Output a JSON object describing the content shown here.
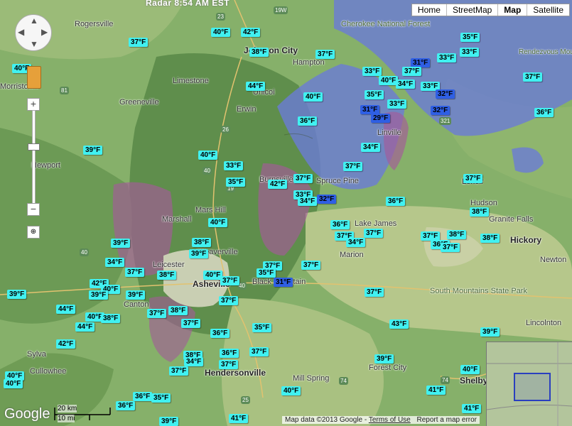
{
  "header": {
    "title": "Radar  8:54 AM EST"
  },
  "map_types": [
    "Home",
    "StreetMap",
    "Map",
    "Satellite"
  ],
  "active_map_type": "Map",
  "places": [
    {
      "name": "Rogersville"
    },
    {
      "name": "Johnson City"
    },
    {
      "name": "Hampton"
    },
    {
      "name": "Cherokee National Forest"
    },
    {
      "name": "Rendezvous Mountain Educational State Forest"
    },
    {
      "name": "Morristown"
    },
    {
      "name": "Limestone"
    },
    {
      "name": "Greeneville"
    },
    {
      "name": "Unicoi"
    },
    {
      "name": "Erwin"
    },
    {
      "name": "Newport"
    },
    {
      "name": "Linville"
    },
    {
      "name": "Burnsville"
    },
    {
      "name": "Spruce Pine"
    },
    {
      "name": "Lenoir"
    },
    {
      "name": "Hudson"
    },
    {
      "name": "Granite Falls"
    },
    {
      "name": "Marshall"
    },
    {
      "name": "Mars Hill"
    },
    {
      "name": "Weaverville"
    },
    {
      "name": "Lake James"
    },
    {
      "name": "Marion"
    },
    {
      "name": "Hickory"
    },
    {
      "name": "Newton"
    },
    {
      "name": "Leicester"
    },
    {
      "name": "Asheville"
    },
    {
      "name": "Black Mountain"
    },
    {
      "name": "Lincolnton"
    },
    {
      "name": "Canton"
    },
    {
      "name": "South Mountains State Park"
    },
    {
      "name": "Sylva"
    },
    {
      "name": "Hendersonville"
    },
    {
      "name": "Forest City"
    },
    {
      "name": "Mill Spring"
    },
    {
      "name": "Shelby"
    },
    {
      "name": "Cullowhee"
    }
  ],
  "temperatures": [
    {
      "t": "40°F"
    },
    {
      "t": "42°F"
    },
    {
      "t": "37°F"
    },
    {
      "t": "38°F"
    },
    {
      "t": "37°F"
    },
    {
      "t": "35°F"
    },
    {
      "t": "33°F"
    },
    {
      "t": "33°F"
    },
    {
      "t": "31°F",
      "cold": true
    },
    {
      "t": "37°F"
    },
    {
      "t": "33°F"
    },
    {
      "t": "40°F"
    },
    {
      "t": "34°F"
    },
    {
      "t": "33°F"
    },
    {
      "t": "32°F",
      "cold": true
    },
    {
      "t": "37°F"
    },
    {
      "t": "40°F"
    },
    {
      "t": "44°F"
    },
    {
      "t": "40°F"
    },
    {
      "t": "35°F"
    },
    {
      "t": "33°F"
    },
    {
      "t": "31°F",
      "cold": true
    },
    {
      "t": "29°F",
      "cold": true
    },
    {
      "t": "32°F",
      "cold": true
    },
    {
      "t": "36°F"
    },
    {
      "t": "36°F"
    },
    {
      "t": "39°F"
    },
    {
      "t": "40°F"
    },
    {
      "t": "34°F"
    },
    {
      "t": "37°F"
    },
    {
      "t": "33°F"
    },
    {
      "t": "35°F"
    },
    {
      "t": "42°F"
    },
    {
      "t": "37°F"
    },
    {
      "t": "33°F"
    },
    {
      "t": "34°F"
    },
    {
      "t": "32°F",
      "cold": true
    },
    {
      "t": "37°F"
    },
    {
      "t": "36°F"
    },
    {
      "t": "38°F"
    },
    {
      "t": "40°F"
    },
    {
      "t": "36°F"
    },
    {
      "t": "37°F"
    },
    {
      "t": "37°F"
    },
    {
      "t": "34°F"
    },
    {
      "t": "38°F"
    },
    {
      "t": "39°F"
    },
    {
      "t": "38°F"
    },
    {
      "t": "39°F"
    },
    {
      "t": "37°F"
    },
    {
      "t": "36°F"
    },
    {
      "t": "37°F"
    },
    {
      "t": "38°F"
    },
    {
      "t": "34°F"
    },
    {
      "t": "37°F"
    },
    {
      "t": "38°F"
    },
    {
      "t": "40°F"
    },
    {
      "t": "37°F"
    },
    {
      "t": "35°F"
    },
    {
      "t": "37°F"
    },
    {
      "t": "31°F",
      "cold": true
    },
    {
      "t": "37°F"
    },
    {
      "t": "39°F"
    },
    {
      "t": "42°F"
    },
    {
      "t": "40°F"
    },
    {
      "t": "39°F"
    },
    {
      "t": "39°F"
    },
    {
      "t": "44°F"
    },
    {
      "t": "37°F"
    },
    {
      "t": "38°F"
    },
    {
      "t": "37°F"
    },
    {
      "t": "40°F"
    },
    {
      "t": "38°F"
    },
    {
      "t": "44°F"
    },
    {
      "t": "37°F"
    },
    {
      "t": "36°F"
    },
    {
      "t": "35°F"
    },
    {
      "t": "43°F"
    },
    {
      "t": "37°F"
    },
    {
      "t": "39°F"
    },
    {
      "t": "42°F"
    },
    {
      "t": "38°F"
    },
    {
      "t": "34°F"
    },
    {
      "t": "36°F"
    },
    {
      "t": "37°F"
    },
    {
      "t": "37°F"
    },
    {
      "t": "39°F"
    },
    {
      "t": "40°F"
    },
    {
      "t": "40°F"
    },
    {
      "t": "37°F"
    },
    {
      "t": "40°F"
    },
    {
      "t": "40°F"
    },
    {
      "t": "41°F"
    },
    {
      "t": "36°F"
    },
    {
      "t": "35°F"
    },
    {
      "t": "36°F"
    },
    {
      "t": "41°F"
    },
    {
      "t": "39°F"
    },
    {
      "t": "41°F"
    }
  ],
  "footer": {
    "scale_km": "20 km",
    "scale_mi": "10 mi",
    "map_data": "Map data ©2013 Google",
    "terms": "Terms of Use",
    "report": "Report a map error",
    "google": "Google"
  },
  "colors": {
    "temp_label": "#41f1f1",
    "temp_cold": "#2f5fe4",
    "radar_snow": "#6a7cd6",
    "radar_mix": "#a45a9a"
  }
}
